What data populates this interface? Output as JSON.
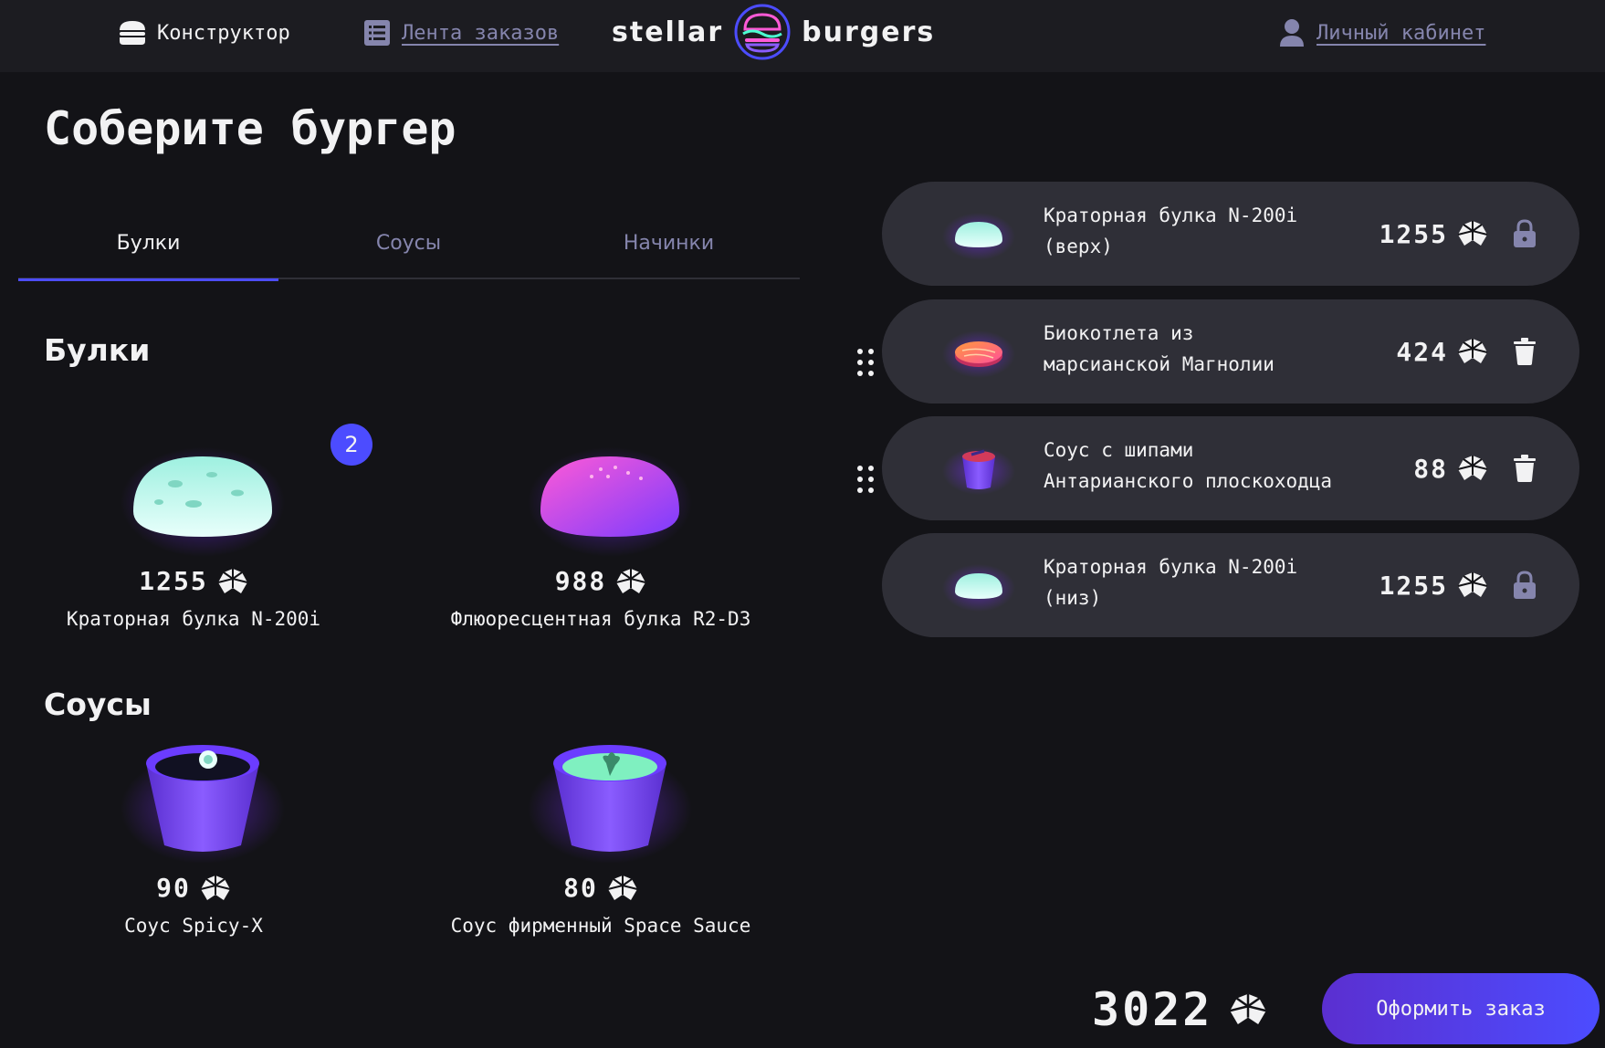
{
  "header": {
    "constructor_label": "Конструктор",
    "feed_label": "Лента заказов",
    "logo_left": "stellar",
    "logo_right": "burgers",
    "profile_label": "Личный кабинет"
  },
  "page_title": "Соберите бургер",
  "tabs": [
    {
      "label": "Булки",
      "active": true
    },
    {
      "label": "Соусы",
      "active": false
    },
    {
      "label": "Начинки",
      "active": false
    }
  ],
  "sections": {
    "buns": {
      "title": "Булки",
      "items": [
        {
          "price": "1255",
          "name": "Краторная булка N-200i",
          "counter": "2",
          "image": "crater-bun"
        },
        {
          "price": "988",
          "name": "Флюоресцентная булка R2-D3",
          "image": "fluorescent-bun"
        }
      ]
    },
    "sauces": {
      "title": "Соусы",
      "items": [
        {
          "price": "90",
          "name": "Соус Spicy-X",
          "image": "spicy-sauce"
        },
        {
          "price": "80",
          "name": "Соус фирменный Space Sauce",
          "image": "space-sauce"
        }
      ]
    }
  },
  "constructor": {
    "items": [
      {
        "name_line1": "Краторная булка N-200i",
        "name_line2": "(верх)",
        "price": "1255",
        "action": "lock-icon",
        "locked": true,
        "image": "crater-bun"
      },
      {
        "name_line1": "Биокотлета из",
        "name_line2": "марсианской Магнолии",
        "price": "424",
        "action": "trash-icon",
        "locked": false,
        "image": "bio-patty"
      },
      {
        "name_line1": "Соус с шипами",
        "name_line2": "Антарианского плоскоходца",
        "price": "88",
        "action": "trash-icon",
        "locked": false,
        "image": "spiked-sauce"
      },
      {
        "name_line1": "Краторная булка N-200i",
        "name_line2": "(низ)",
        "price": "1255",
        "action": "lock-icon",
        "locked": true,
        "image": "crater-bun"
      }
    ],
    "total": "3022",
    "order_button": "Оформить заказ"
  },
  "colors": {
    "background": "#131317",
    "header": "#1c1c21",
    "row": "#2f2f37",
    "accent": "#4c4cff",
    "muted": "#8585ad"
  }
}
